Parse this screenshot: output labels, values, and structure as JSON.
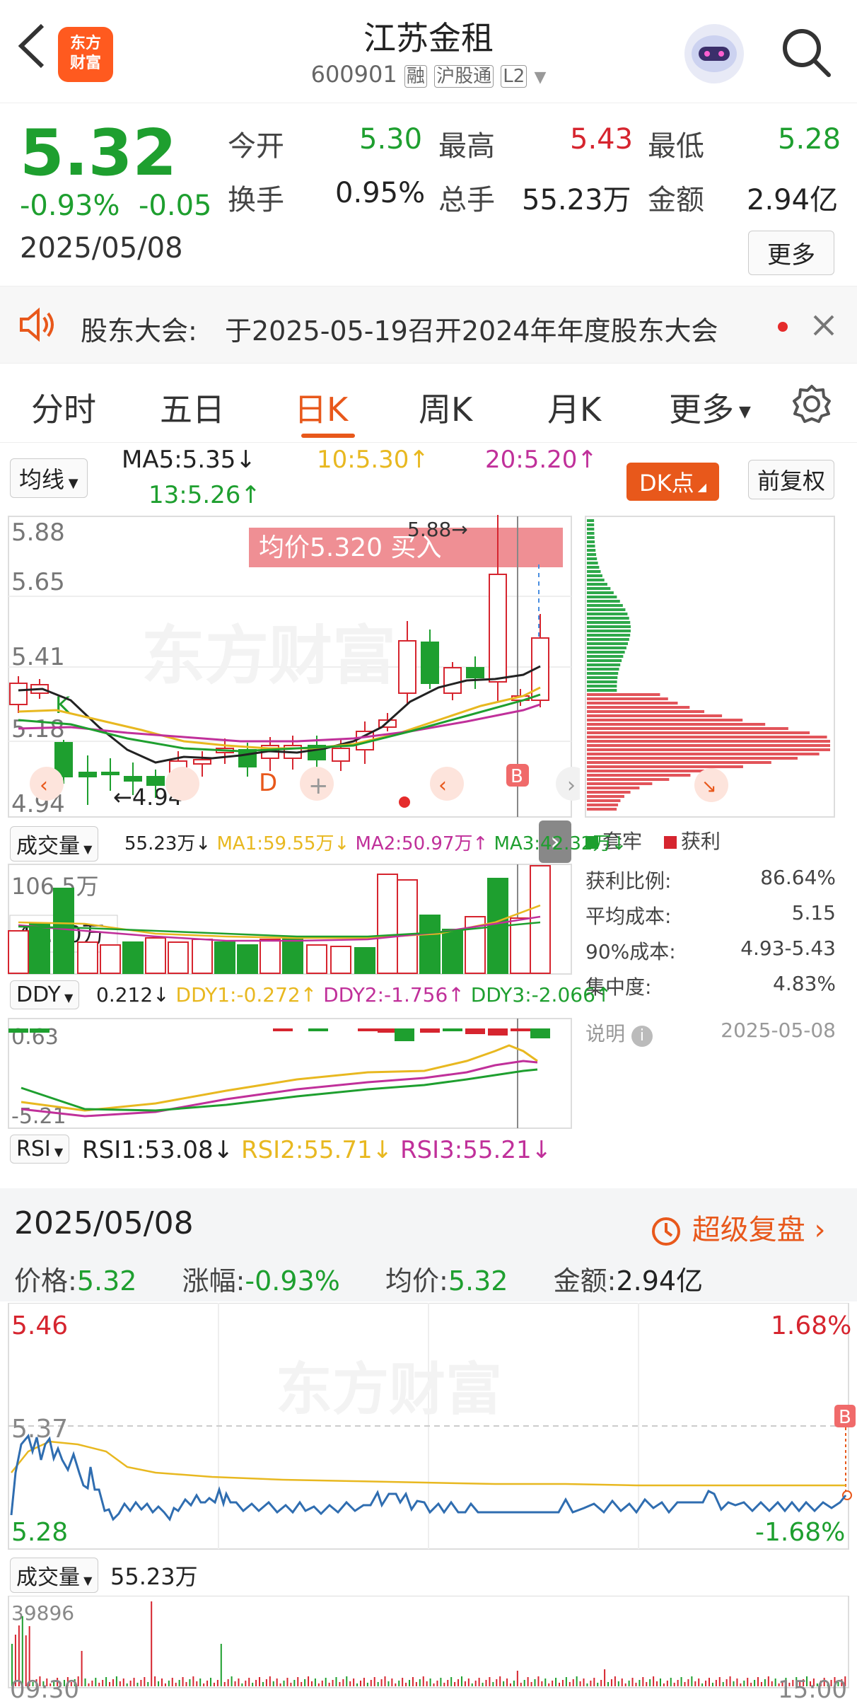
{
  "header": {
    "back_label": "‹",
    "logo_text_1": "东方",
    "logo_text_2": "财富",
    "title": "江苏金租",
    "code": "600901",
    "tag_rong": "融",
    "tag_hgt": "沪股通",
    "tag_l2": "L2"
  },
  "quote": {
    "price": "5.32",
    "change_pct": "-0.93%",
    "change": "-0.05",
    "date": "2025/05/08",
    "open_label": "今开",
    "open": "5.30",
    "high_label": "最高",
    "high": "5.43",
    "low_label": "最低",
    "low": "5.28",
    "turnover_label": "换手",
    "turnover": "0.95%",
    "volume_label": "总手",
    "volume": "55.23万",
    "amount_label": "金额",
    "amount": "2.94亿",
    "more_label": "更多"
  },
  "notice": {
    "label": "股东大会:",
    "text": "于2025-05-19召开2024年年度股东大会"
  },
  "tabs": {
    "items": [
      "分时",
      "五日",
      "日K",
      "周K",
      "月K",
      "更多"
    ],
    "active": "日K"
  },
  "kline": {
    "ma_select": "均线",
    "ma5": "MA5:5.35↓",
    "ma10": "10:5.30↑",
    "ma20": "20:5.20↑",
    "ma13": "13:5.26↑",
    "dk_button": "DK点",
    "fq_button": "前复权",
    "price_labels": [
      "5.88",
      "5.65",
      "5.41",
      "5.18",
      "4.94"
    ],
    "banner_text": "均价5.320  买入",
    "high_mark": "5.88→",
    "low_mark": "←4.94",
    "k_mark": "K",
    "d_mark": "D",
    "b_mark": "B",
    "colors": {
      "up": "#d6252f",
      "down": "#1e9f2f",
      "ma5": "#222222",
      "ma10": "#e8b820",
      "ma20": "#c0309a",
      "ma13": "#1e9f2f"
    }
  },
  "volume": {
    "select": "成交量",
    "value": "55.23万↓",
    "ma1": "MA1:59.55万↓",
    "ma2": "MA2:50.97万↑",
    "ma3": "MA3:42.32万↓",
    "top_label": "106.5万",
    "cursor_label": "40.90万"
  },
  "ddy": {
    "select": "DDY",
    "value": "0.212↓",
    "ddy1": "DDY1:-0.272↑",
    "ddy2": "DDY2:-1.756↑",
    "ddy3": "DDY3:-2.066↑",
    "top_label": "0.63",
    "bottom_label": "-5.21"
  },
  "rsi": {
    "select": "RSI",
    "rsi1": "RSI1:53.08↓",
    "rsi2": "RSI2:55.71↓",
    "rsi3": "RSI3:55.21↓"
  },
  "chip_dist": {
    "legend_trapped": "套牢",
    "legend_profit": "获利",
    "rows": [
      {
        "label": "获利比例:",
        "value": "86.64%"
      },
      {
        "label": "平均成本:",
        "value": "5.15"
      },
      {
        "label": "90%成本:",
        "value": "4.93-5.43"
      },
      {
        "label": "集中度:",
        "value": "4.83%"
      }
    ],
    "note_label": "说明",
    "note_date": "2025-05-08"
  },
  "intraday": {
    "date": "2025/05/08",
    "replay_label": "超级复盘",
    "price_label": "价格:",
    "price": "5.32",
    "change_label": "涨幅:",
    "change": "-0.93%",
    "avg_label": "均价:",
    "avg": "5.32",
    "amount_label": "金额:",
    "amount": "2.94亿",
    "top_price": "5.46",
    "top_pct": "1.68%",
    "mid_price": "5.37",
    "bottom_price": "5.28",
    "bottom_pct": "-1.68%",
    "b_mark": "B",
    "vol_select": "成交量",
    "vol_value": "55.23万",
    "vol_top": "39896",
    "time_start": "09:30",
    "time_end": "15:00"
  }
}
